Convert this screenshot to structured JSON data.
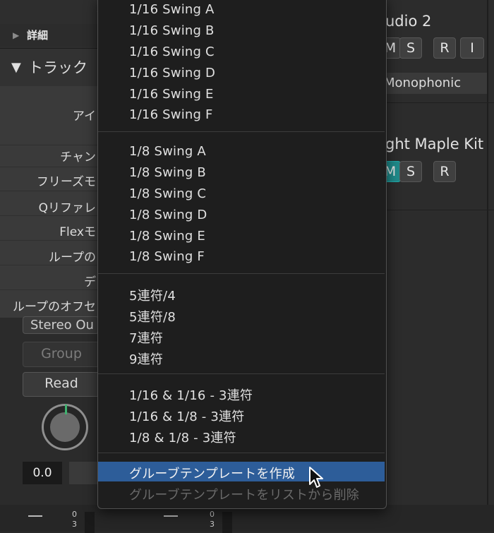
{
  "inspector": {
    "details_label": "詳細",
    "track_label": "トラック",
    "partial_top": "ク",
    "rows": [
      "アイ",
      "チャン",
      "フリーズモ",
      "Qリファレ",
      "Flexモ",
      "ループの",
      "デ",
      "ループのオフセ"
    ]
  },
  "mixer": {
    "output": "Stereo Ou",
    "group": "Group",
    "automation": "Read",
    "value": "0.0",
    "meter_a": "0",
    "meter_b": "3"
  },
  "channels": {
    "track1_name": "udio 2",
    "track1_buttons": [
      "M",
      "S",
      "R",
      "I"
    ],
    "mode": "Monophonic",
    "track2_name": "ght Maple Kit",
    "track2_buttons": [
      "M",
      "S",
      "R"
    ]
  },
  "menu": {
    "items_a": [
      "1/16 Swing A",
      "1/16 Swing B",
      "1/16 Swing C",
      "1/16 Swing D",
      "1/16 Swing E",
      "1/16 Swing F"
    ],
    "items_b": [
      "1/8 Swing A",
      "1/8 Swing B",
      "1/8 Swing C",
      "1/8 Swing D",
      "1/8 Swing E",
      "1/8 Swing F"
    ],
    "items_c": [
      "5連符/4",
      "5連符/8",
      "7連符",
      "9連符"
    ],
    "items_d": [
      "1/16 & 1/16 - 3連符",
      "1/16 & 1/8 - 3連符",
      "1/8 & 1/8 - 3連符"
    ],
    "create_template": "グルーブテンプレートを作成",
    "remove_template": "グルーブテンプレートをリストから削除"
  },
  "colors": {
    "highlight": "#2d5d99",
    "accent_green": "#3fb26f",
    "mute_teal": "#1f8a8a"
  }
}
